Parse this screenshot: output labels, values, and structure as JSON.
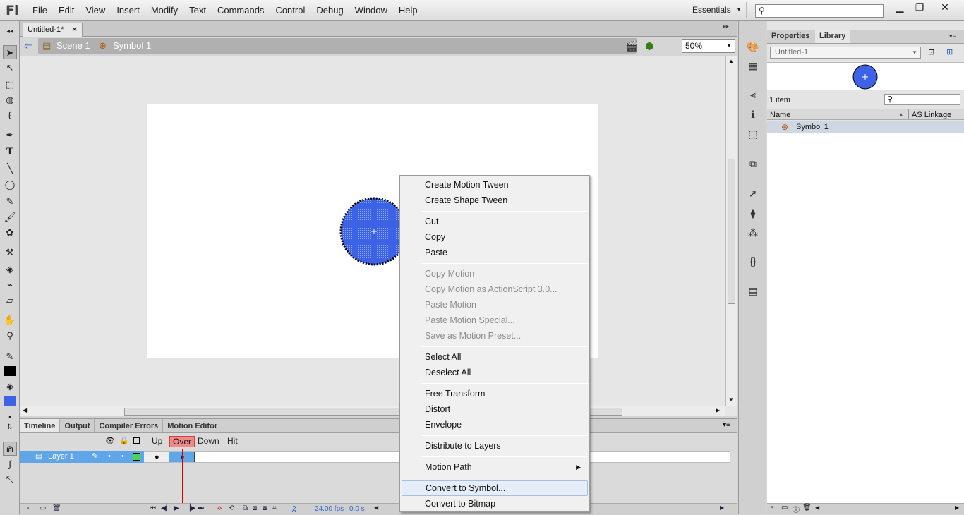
{
  "app": {
    "logo": "Fl"
  },
  "menu": [
    "File",
    "Edit",
    "View",
    "Insert",
    "Modify",
    "Text",
    "Commands",
    "Control",
    "Debug",
    "Window",
    "Help"
  ],
  "workspace": "Essentials",
  "document": {
    "tab": "Untitled-1*",
    "scene": "Scene 1",
    "symbol": "Symbol 1",
    "zoom": "50%"
  },
  "timeline": {
    "tabs": [
      "Timeline",
      "Output",
      "Compiler Errors",
      "Motion Editor"
    ],
    "frame_labels": [
      "Up",
      "Over",
      "Down",
      "Hit"
    ],
    "layer": "Layer 1",
    "current_frame": "2",
    "fps": "24.00 fps",
    "time": "0.0 s"
  },
  "library": {
    "tabs": [
      "Properties",
      "Library"
    ],
    "document": "Untitled-1",
    "count": "1 item",
    "col_name": "Name",
    "col_linkage": "AS Linkage",
    "items": [
      "Symbol 1"
    ]
  },
  "context_menu": [
    {
      "label": "Create Motion Tween",
      "enabled": true
    },
    {
      "label": "Create Shape Tween",
      "enabled": true
    },
    {
      "label": "Cut",
      "enabled": true
    },
    {
      "label": "Copy",
      "enabled": true
    },
    {
      "label": "Paste",
      "enabled": true
    },
    {
      "label": "Copy Motion",
      "enabled": false
    },
    {
      "label": "Copy Motion as ActionScript 3.0...",
      "enabled": false
    },
    {
      "label": "Paste Motion",
      "enabled": false
    },
    {
      "label": "Paste Motion Special...",
      "enabled": false
    },
    {
      "label": "Save as Motion Preset...",
      "enabled": false
    },
    {
      "label": "Select All",
      "enabled": true
    },
    {
      "label": "Deselect All",
      "enabled": true
    },
    {
      "label": "Free Transform",
      "enabled": true
    },
    {
      "label": "Distort",
      "enabled": true
    },
    {
      "label": "Envelope",
      "enabled": true
    },
    {
      "label": "Distribute to Layers",
      "enabled": true
    },
    {
      "label": "Motion Path",
      "enabled": true
    },
    {
      "label": "Convert to Symbol...",
      "enabled": true
    },
    {
      "label": "Convert to Bitmap",
      "enabled": true
    }
  ],
  "colors": {
    "circle_fill": "#3c63e6",
    "layer_highlight": "#5fa6e8",
    "over_label": "#f08a8a"
  }
}
